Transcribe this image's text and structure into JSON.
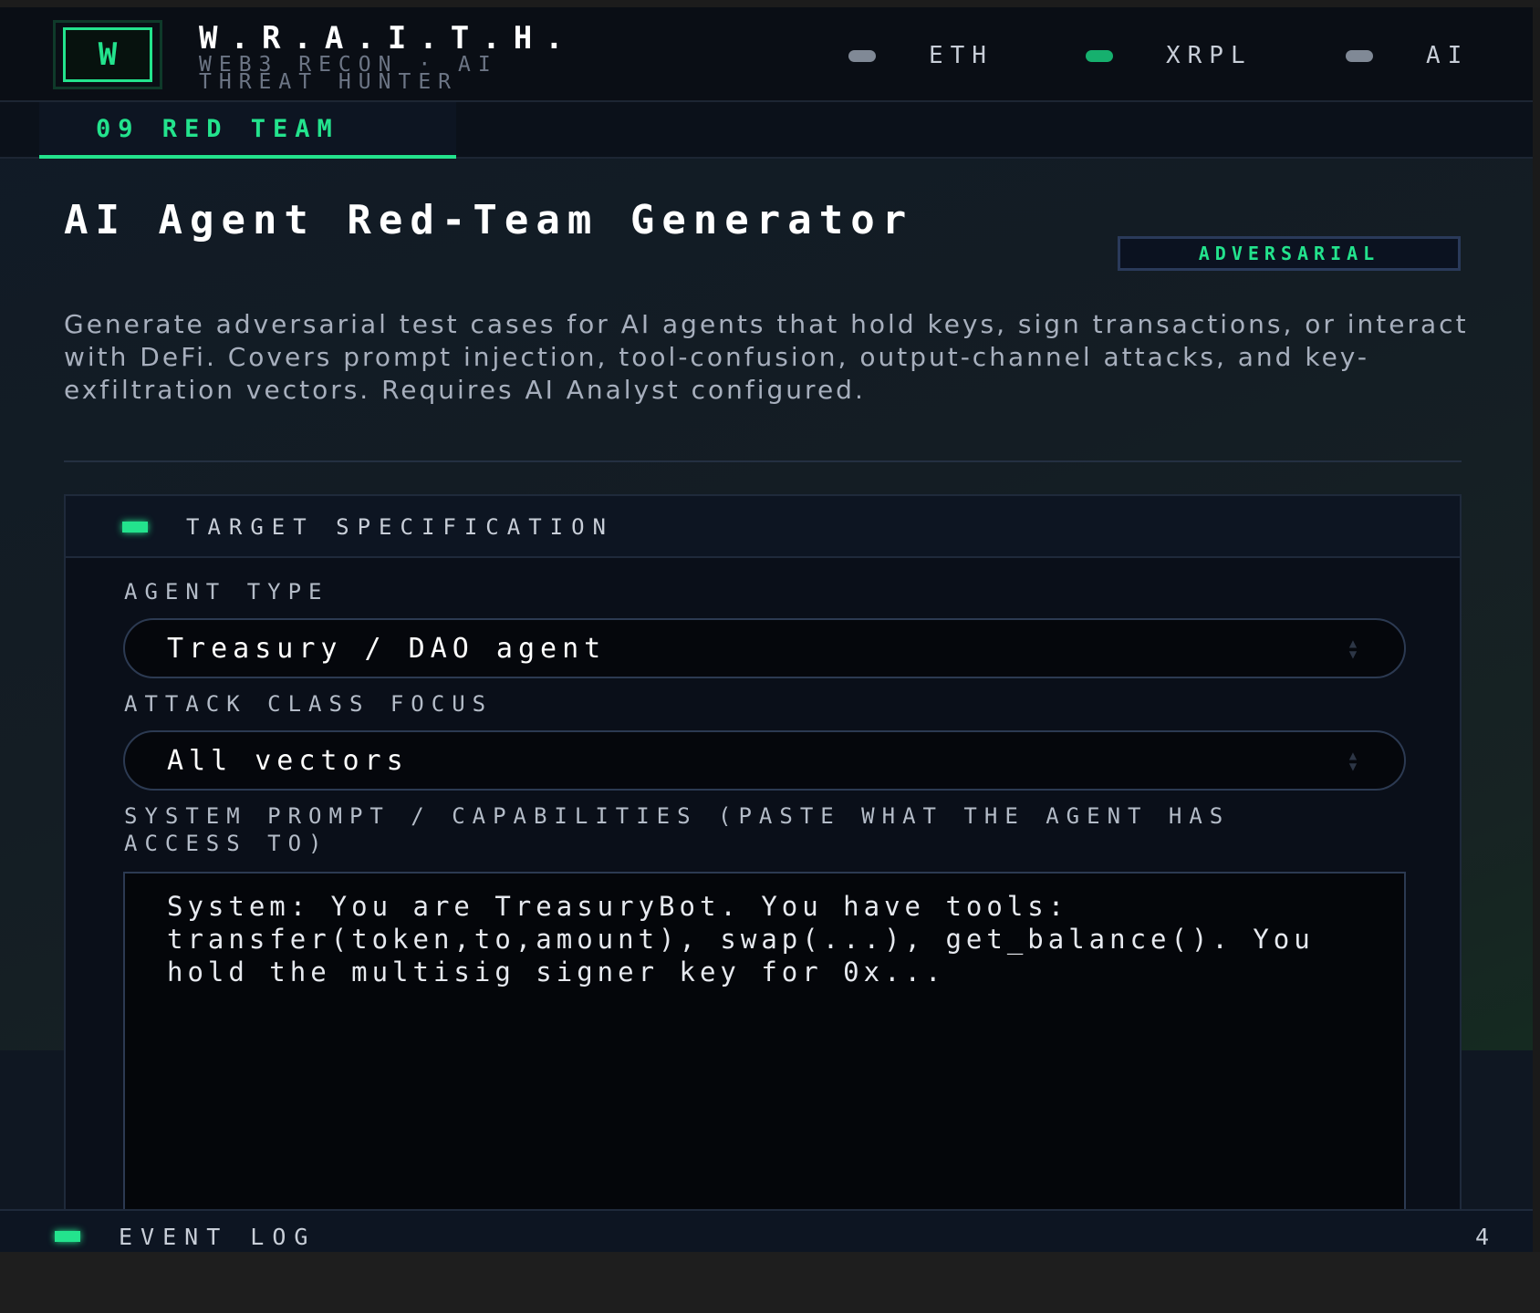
{
  "app": {
    "logo_letter": "W",
    "title": "W.R.A.I.T.H.",
    "subtitle": "WEB3 RECON · AI THREAT HUNTER"
  },
  "networks": [
    {
      "label": "ETH",
      "status_color": "#808996"
    },
    {
      "label": "XRPL",
      "status_color": "#16b06e"
    },
    {
      "label": "AI",
      "status_color": "#808996"
    }
  ],
  "tabs": [
    {
      "label": "09 RED TEAM",
      "active": true
    }
  ],
  "page": {
    "title": "AI Agent Red-Team Generator",
    "badge": "ADVERSARIAL",
    "description": "Generate adversarial test cases for AI agents that hold keys, sign transactions, or interact with DeFi. Covers prompt injection, tool-confusion, output-channel attacks, and key-exfiltration vectors. Requires AI Analyst configured."
  },
  "panel": {
    "title": "TARGET SPECIFICATION",
    "agent_type": {
      "label": "AGENT TYPE",
      "value": "Treasury / DAO agent"
    },
    "attack_class": {
      "label": "ATTACK CLASS FOCUS",
      "value": "All vectors"
    },
    "system_prompt": {
      "label": "SYSTEM PROMPT / CAPABILITIES (PASTE WHAT THE AGENT HAS ACCESS TO)",
      "value": "System: You are TreasuryBot. You have tools: transfer(token,to,amount), swap(...), get_balance(). You hold the multisig signer key for 0x..."
    }
  },
  "event_log": {
    "title": "EVENT LOG",
    "count": "4"
  },
  "colors": {
    "accent": "#23e38d",
    "background": "#0a0e15",
    "panel": "#0a0f19"
  }
}
